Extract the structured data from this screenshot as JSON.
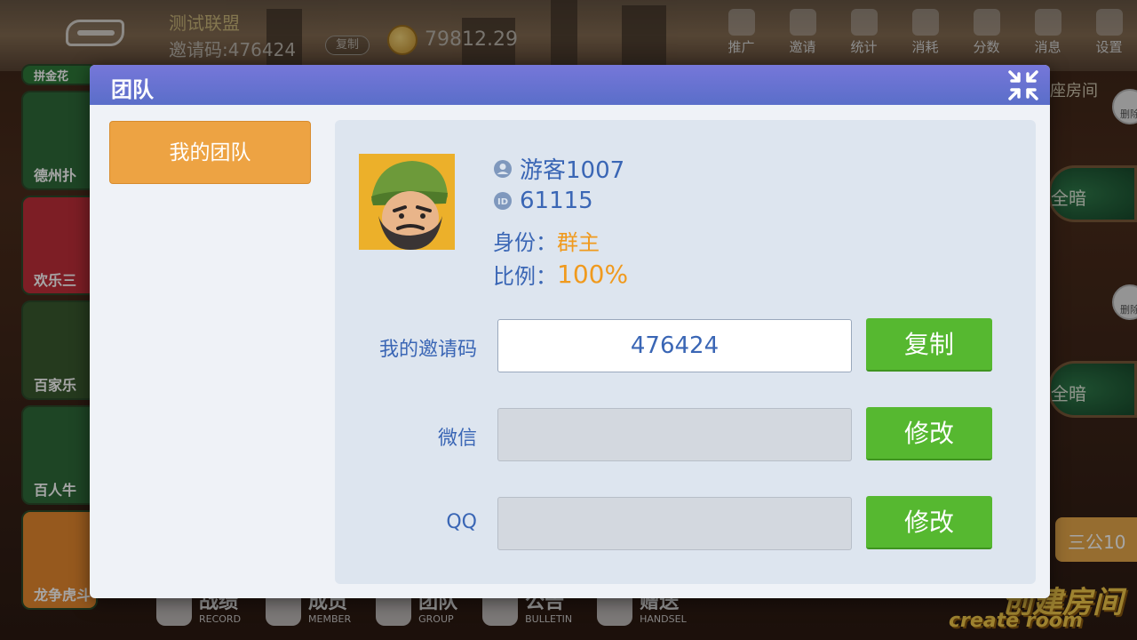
{
  "background": {
    "alliance_name": "测试联盟",
    "invite_label": "邀请码:476424",
    "invite_copy": "复制",
    "coins": "79812.29",
    "top_nav": [
      {
        "icon": "promote-icon",
        "label": "推广"
      },
      {
        "icon": "invite-icon",
        "label": "邀请"
      },
      {
        "icon": "stats-icon",
        "label": "统计"
      },
      {
        "icon": "consume-icon",
        "label": "消耗"
      },
      {
        "icon": "score-icon",
        "label": "分数"
      },
      {
        "icon": "message-icon",
        "label": "消息"
      },
      {
        "icon": "settings-icon",
        "label": "设置"
      }
    ],
    "games": [
      {
        "label": "拼金花",
        "color": "#2f7a3a"
      },
      {
        "label": "德州扑",
        "color": "#2f6a3a"
      },
      {
        "label": "欢乐三",
        "color": "#c02f3a"
      },
      {
        "label": "百家乐",
        "color": "#3a5a2f"
      },
      {
        "label": "百人牛",
        "color": "#2f6a3a"
      },
      {
        "label": "龙争虎斗",
        "color": "#e7892f"
      }
    ],
    "right_panel": {
      "room_label": "座房间",
      "table_1": "全暗",
      "table_2": "全暗",
      "delete_label": "删除",
      "sangong": "三公10",
      "create_room_zh": "创建房间",
      "create_room_en": "create room"
    },
    "bottom_bar": [
      {
        "icon": "record-icon",
        "zh": "战绩",
        "en": "RECORD"
      },
      {
        "icon": "member-icon",
        "zh": "成员",
        "en": "MEMBER"
      },
      {
        "icon": "group-icon",
        "zh": "团队",
        "en": "GROUP"
      },
      {
        "icon": "bulletin-icon",
        "zh": "公告",
        "en": "BULLETIN"
      },
      {
        "icon": "handsel-icon",
        "zh": "赠送",
        "en": "HANDSEL"
      }
    ]
  },
  "modal": {
    "title": "团队",
    "side_tab": "我的团队",
    "profile": {
      "nickname": "游客1007",
      "user_id": "61115",
      "role_label": "身份：",
      "role_value": "群主",
      "ratio_label": "比例：",
      "ratio_value": "100%"
    },
    "form": {
      "invite_code_label": "我的邀请码",
      "invite_code_value": "476424",
      "copy_button": "复制",
      "wechat_label": "微信",
      "wechat_value": "",
      "wechat_button": "修改",
      "qq_label": "QQ",
      "qq_value": "",
      "qq_button": "修改"
    }
  }
}
